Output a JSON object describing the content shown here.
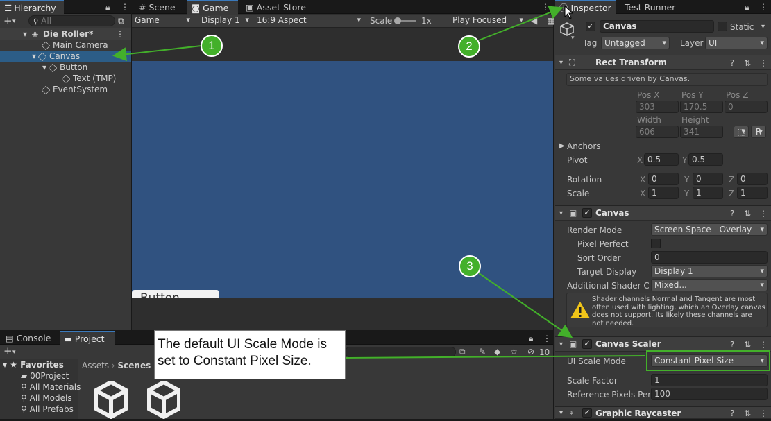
{
  "hierarchy": {
    "tab": "Hierarchy",
    "search_placeholder": "All",
    "scene": "Die Roller*",
    "items": [
      "Main Camera",
      "Canvas",
      "Button",
      "Text (TMP)",
      "EventSystem"
    ]
  },
  "center_tabs": [
    "Scene",
    "Game",
    "Asset Store"
  ],
  "game_toolbar": {
    "mode": "Game",
    "display": "Display 1",
    "aspect": "16:9 Aspect",
    "scale_label": "Scale",
    "scale_value": "1x",
    "play_mode": "Play Focused"
  },
  "game_view": {
    "button_text": "Button"
  },
  "bottom_tabs": [
    "Console",
    "Project"
  ],
  "project": {
    "favorites_label": "Favorites",
    "favorites": [
      "00Project",
      "All Materials",
      "All Models",
      "All Prefabs"
    ],
    "breadcrumb": [
      "Assets",
      "Scenes"
    ],
    "badge": "10"
  },
  "inspector": {
    "tabs": [
      "Inspector",
      "Test Runner"
    ],
    "object_name": "Canvas",
    "static_label": "Static",
    "tag_label": "Tag",
    "tag_value": "Untagged",
    "layer_label": "Layer",
    "layer_value": "UI",
    "rect_transform": {
      "title": "Rect Transform",
      "note": "Some values driven by Canvas.",
      "labels": [
        "Pos X",
        "Pos Y",
        "Pos Z",
        "Width",
        "Height"
      ],
      "values": [
        "303",
        "170.5",
        "0",
        "606",
        "341"
      ],
      "r_button": "R",
      "anchors": "Anchors",
      "pivot": "Pivot",
      "pivot_x": "0.5",
      "pivot_y": "0.5",
      "rotation": "Rotation",
      "rotation_values": [
        "0",
        "0",
        "0"
      ],
      "scale": "Scale",
      "scale_values": [
        "1",
        "1",
        "1"
      ],
      "axes": [
        "X",
        "Y",
        "Z"
      ]
    },
    "canvas": {
      "title": "Canvas",
      "render_mode_label": "Render Mode",
      "render_mode": "Screen Space - Overlay",
      "pixel_perfect": "Pixel Perfect",
      "sort_order_label": "Sort Order",
      "sort_order": "0",
      "target_display_label": "Target Display",
      "target_display": "Display 1",
      "shader_label": "Additional Shader Ch",
      "shader_value": "Mixed...",
      "warning": "Shader channels Normal and Tangent are most often used with lighting, which an Overlay canvas does not support. Its likely these channels are not needed."
    },
    "canvas_scaler": {
      "title": "Canvas Scaler",
      "ui_scale_mode_label": "UI Scale Mode",
      "ui_scale_mode": "Constant Pixel Size",
      "scale_factor_label": "Scale Factor",
      "scale_factor": "1",
      "ref_pixels_label": "Reference Pixels Per",
      "ref_pixels": "100"
    },
    "graphic_raycaster": {
      "title": "Graphic Raycaster"
    }
  },
  "annotation": {
    "callout": "The default UI Scale Mode is set to Constant Pixel Size.",
    "markers": [
      "1",
      "2",
      "3"
    ],
    "color": "#43b02a"
  },
  "colors": {
    "game_bg": "#305280",
    "selection": "#2c5d87",
    "tab_accent": "#3a79bb"
  }
}
